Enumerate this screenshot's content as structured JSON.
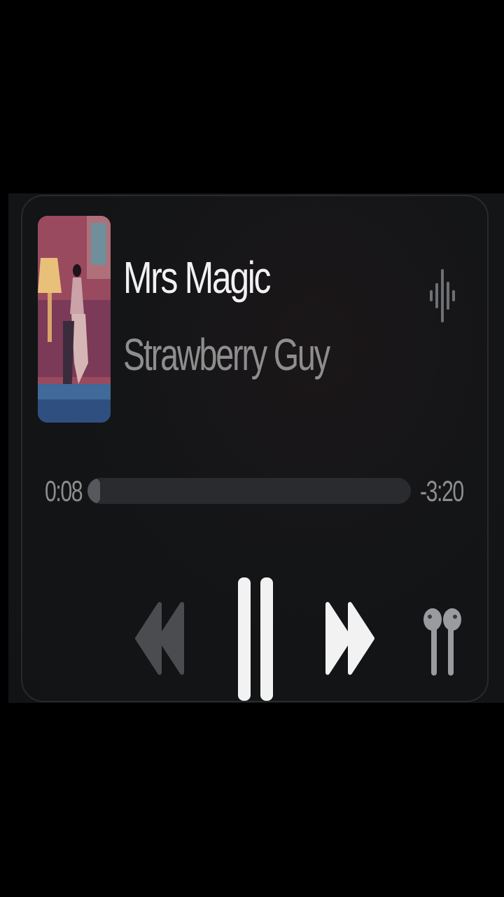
{
  "now_playing": {
    "title": "Mrs Magic",
    "artist": "Strawberry Guy",
    "artwork_icon": "album-artwork",
    "waveform_icon": "waveform-icon"
  },
  "progress": {
    "elapsed": "0:08",
    "remaining": "-3:20",
    "fraction": 0.04
  },
  "controls": {
    "rewind_icon": "rewind-icon",
    "pause_icon": "pause-icon",
    "forward_icon": "fast-forward-icon",
    "output_icon": "airpods-icon"
  },
  "colors": {
    "title": "#f1f1f1",
    "secondary": "#8e8e8e",
    "track": "#2a2b2e",
    "fill": "#56585c"
  }
}
